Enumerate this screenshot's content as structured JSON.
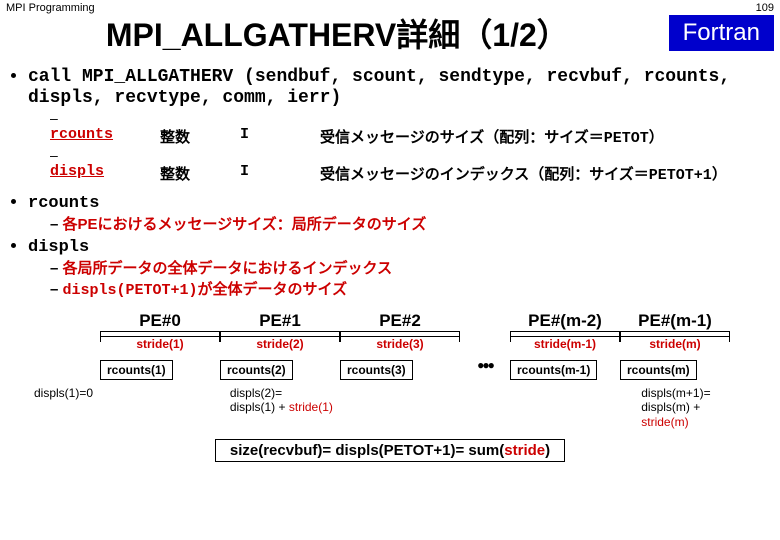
{
  "header": {
    "left": "MPI Programming",
    "right": "109"
  },
  "title": "MPI_ALLGATHERV詳細（1/2）",
  "lang_badge": "Fortran",
  "call_line": "call MPI_ALLGATHERV (sendbuf, scount, sendtype, recvbuf, rcounts, displs, recvtype, comm, ierr)",
  "params": [
    {
      "name": "rcounts",
      "type": "整数",
      "io": "I",
      "desc": "受信メッセージのサイズ（配列：サイズ＝PETOT）"
    },
    {
      "name": "displs",
      "type": "整数",
      "io": "I",
      "desc": "受信メッセージのインデックス（配列：サイズ＝PETOT+1）"
    }
  ],
  "notes": {
    "rcounts": {
      "label": "rcounts",
      "lines": [
        "各PEにおけるメッセージサイズ：局所データのサイズ"
      ]
    },
    "displs": {
      "label": "displs",
      "lines": [
        "各局所データの全体データにおけるインデックス",
        "displs(PETOT+1)が全体データのサイズ"
      ]
    }
  },
  "diagram": {
    "pe": [
      "",
      "PE#0",
      "PE#1",
      "PE#2",
      "",
      "PE#(m-2)",
      "PE#(m-1)"
    ],
    "stride": [
      "",
      "stride(1)",
      "stride(2)",
      "stride(3)",
      "",
      "stride(m-1)",
      "stride(m)"
    ],
    "rc": [
      "",
      "rcounts(1)",
      "rcounts(2)",
      "rcounts(3)",
      "",
      "rcounts(m-1)",
      "rcounts(m)"
    ],
    "dots": "●●●",
    "displs_left": {
      "label": "displs(1)=0"
    },
    "displs_2": {
      "l1": "displs(2)=",
      "l2a": "displs(1) + ",
      "l2b": "stride(1)"
    },
    "displs_m1": {
      "l1": "displs(m+1)=",
      "l2a": "displs(m) + ",
      "l2b": "stride(m)"
    }
  },
  "bottom": {
    "a": "size(recvbuf)= displs(PETOT+1)= sum(",
    "b": "stride",
    "c": ")"
  }
}
